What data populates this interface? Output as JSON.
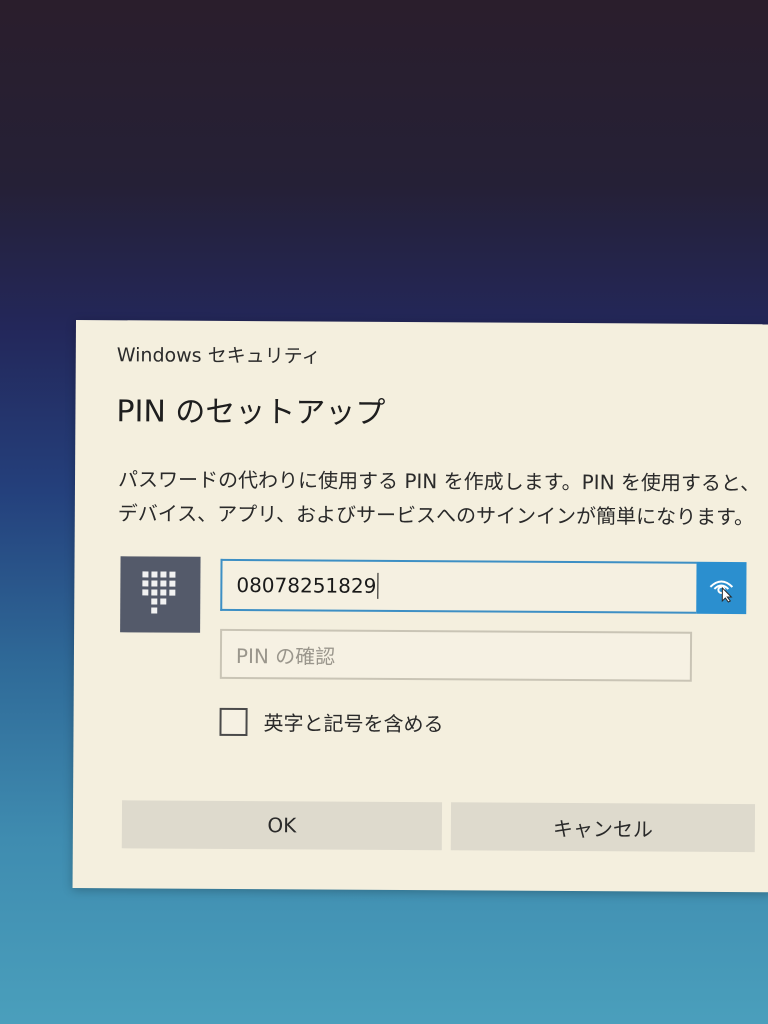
{
  "dialog": {
    "caption": "Windows セキュリティ",
    "title": "PIN のセットアップ",
    "description_line1": "パスワードの代わりに使用する PIN を作成します。PIN を使用すると、",
    "description_line2": "デバイス、アプリ、およびサービスへのサインインが簡単になります。",
    "keypad_icon": "keypad-icon",
    "pin_field": {
      "value": "08078251829",
      "reveal_icon": "reveal-password-icon"
    },
    "confirm_field": {
      "placeholder": "PIN の確認",
      "value": ""
    },
    "checkbox": {
      "label": "英字と記号を含める",
      "checked": false
    },
    "buttons": {
      "ok": "OK",
      "cancel": "キャンセル"
    }
  },
  "colors": {
    "dialog_bg": "#f4efde",
    "accent": "#2b8fcf",
    "tile": "#545a6a",
    "button_bg": "#dedacd"
  }
}
